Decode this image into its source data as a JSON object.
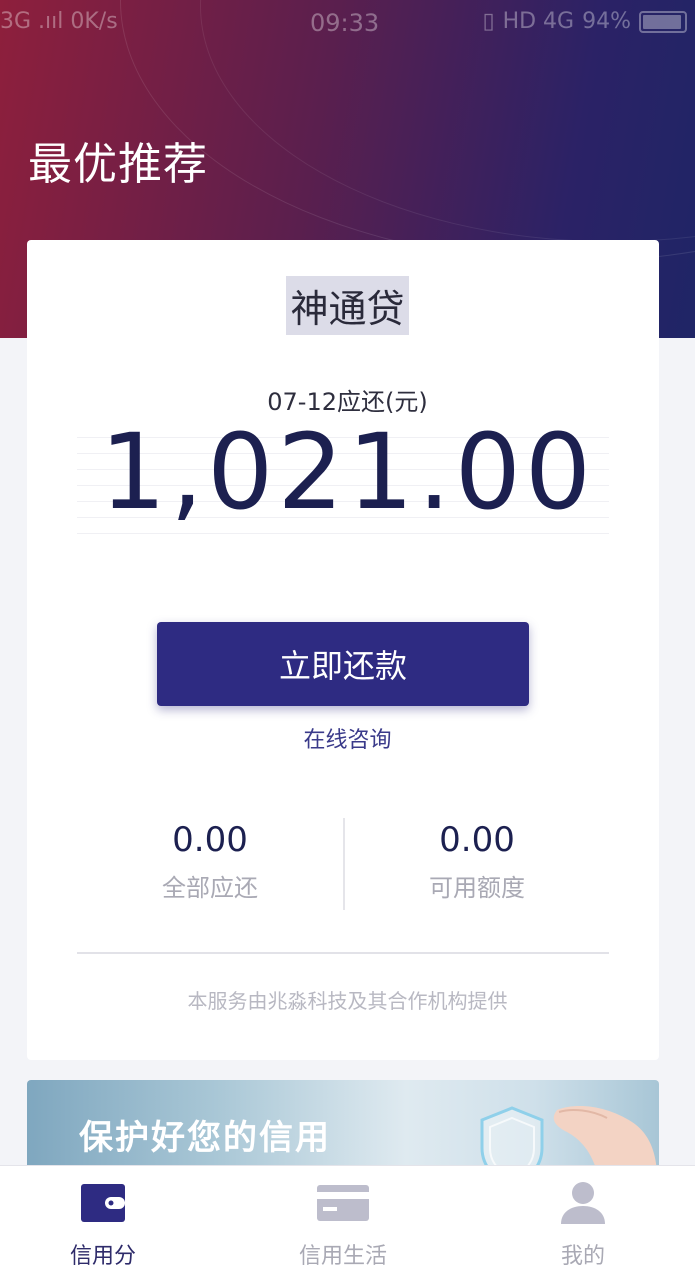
{
  "status_bar": {
    "left": "3G .ııl  0K/s",
    "time": "09:33",
    "network": "HD 4G",
    "battery": "94%",
    "battery_level": 0.94
  },
  "header": {
    "title": "最优推荐"
  },
  "card": {
    "product_name": "神通贷",
    "due_label": "07-12应还(元)",
    "amount": "1,021.00",
    "repay_button": "立即还款",
    "consult_link": "在线咨询",
    "stats": [
      {
        "value": "0.00",
        "label": "全部应还"
      },
      {
        "value": "0.00",
        "label": "可用额度"
      }
    ],
    "provider_note": "本服务由兆淼科技及其合作机构提供"
  },
  "banner": {
    "text": "保护好您的信用"
  },
  "tabbar": {
    "items": [
      {
        "label": "信用分",
        "icon": "wallet-icon",
        "active": true
      },
      {
        "label": "信用生活",
        "icon": "card-icon",
        "active": false
      },
      {
        "label": "我的",
        "icon": "person-icon",
        "active": false
      }
    ]
  },
  "colors": {
    "primary": "#2e2b82",
    "amount_text": "#1c2050",
    "header_gradient_start": "#8e1f3c",
    "header_gradient_end": "#1f2566",
    "muted_text": "#a9a9b4"
  }
}
